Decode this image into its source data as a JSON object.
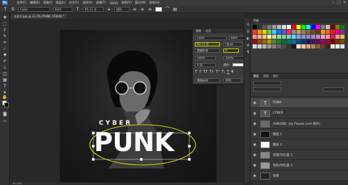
{
  "app": {
    "logo": "Ps"
  },
  "menubar": {
    "items": [
      "文件(F)",
      "编辑(E)",
      "图像(I)",
      "图层(L)",
      "文字(Y)",
      "选择(S)",
      "滤镜(T)",
      "3D(D)",
      "视图(V)",
      "窗口(W)",
      "帮助(H)"
    ],
    "window_controls": [
      "–",
      "□",
      "✕"
    ]
  },
  "optionsbar": {
    "font_family": "Cubic",
    "font_style": "Bold",
    "font_size": "95.11 点",
    "antialias": "锐利",
    "color": "#ffffff"
  },
  "document_tab": {
    "title": "卡夫卡.jpg @ 33.3% (PUNK, RGB/8) *"
  },
  "canvas": {
    "headline_top": "CYBER",
    "headline_main": "PUNK",
    "highlight_color": "#d3d400"
  },
  "status": {
    "zoom": "33.33%"
  },
  "character_panel": {
    "tabs": [
      "字符",
      "段落"
    ],
    "font_family": "Cubic",
    "font_style": "Bold",
    "size": "95.11 点",
    "leading": "(自动)",
    "tracking": "0",
    "kerning": "度量标准",
    "vertical_scale": "100%",
    "horizontal_scale": "100%",
    "baseline": "0 点",
    "color_label": "颜色:",
    "language": "美国英语",
    "antialias": "锐利"
  },
  "swatches_panel": {
    "title": "色板",
    "colors": [
      "#000000",
      "#333333",
      "#555555",
      "#777777",
      "#999999",
      "#bbbbbb",
      "#dddddd",
      "#ffffff",
      "#ff0000",
      "#ffff00",
      "#00ff00",
      "#00ffff",
      "#0000ff",
      "#ff00ff",
      "#808080",
      "#c0c0c0",
      "#800000",
      "#808000",
      "#008000",
      "#ff3b30",
      "#ff9500",
      "#ffcc00",
      "#4cd964",
      "#5ac8fa",
      "#007aff",
      "#5856d6",
      "#ff2d55",
      "#8e8e93",
      "#c69c6d",
      "#a67c52",
      "#8c6239",
      "#754c24",
      "#603913",
      "#f7941d",
      "#f26522",
      "#ed1c24",
      "#ec008c",
      "#92278f",
      "#f69679",
      "#f9ad81",
      "#fdc68a",
      "#fff79a",
      "#c4df9b",
      "#a3d39c",
      "#82ca9d",
      "#7bcdc8",
      "#6ecff6",
      "#7ea7d8",
      "#8493ca",
      "#8882be",
      "#a187be",
      "#bc8dbf",
      "#f49ac2",
      "#f6989d",
      "#ed145b",
      "#f7977a",
      "#fbaf5c",
      "#9e0b0f",
      "#a0410d",
      "#a36209",
      "#aba000",
      "#598527",
      "#1a7b30",
      "#007236",
      "#00746b",
      "#0076a3",
      "#004b80",
      "#003471",
      "#1b1464",
      "#440e62",
      "#630460",
      "#9e005d",
      "#9e0039",
      "#790000",
      "#7b2e00",
      "#7d4900",
      "#d9d9d9",
      "#cccccc",
      "#b3b3b3",
      "#999999",
      "#808080",
      "#666666",
      "#4d4d4d",
      "#333333",
      "#1a1a1a",
      "#f2e4c8",
      "#e8c9a0",
      "#d4a373",
      "#b5835a",
      "#8b5a3c",
      "#6b3e26",
      "#40221a",
      "#ffe0e0",
      "#e0ffe0",
      "#e0e0ff"
    ]
  },
  "layers_panel": {
    "tabs": [
      "图层",
      "通道",
      "路径"
    ],
    "layers": [
      {
        "name": "PUNK",
        "thumb": "T",
        "selected": true
      },
      {
        "name": "CYBER",
        "thumb": "T",
        "selected": false
      },
      {
        "name": "SUNLINE（by Pexels.com 照片）",
        "thumb": "",
        "selected": false
      },
      {
        "name": "图层 1",
        "thumb": "",
        "selected": false
      },
      {
        "name": "图层 2",
        "thumb": "",
        "selected": false
      },
      {
        "name": "亮度/对比度 1",
        "thumb": "",
        "selected": false
      },
      {
        "name": "色阶/对比度 2",
        "thumb": "",
        "selected": false
      },
      {
        "name": "背景",
        "thumb": "",
        "selected": false
      }
    ]
  }
}
